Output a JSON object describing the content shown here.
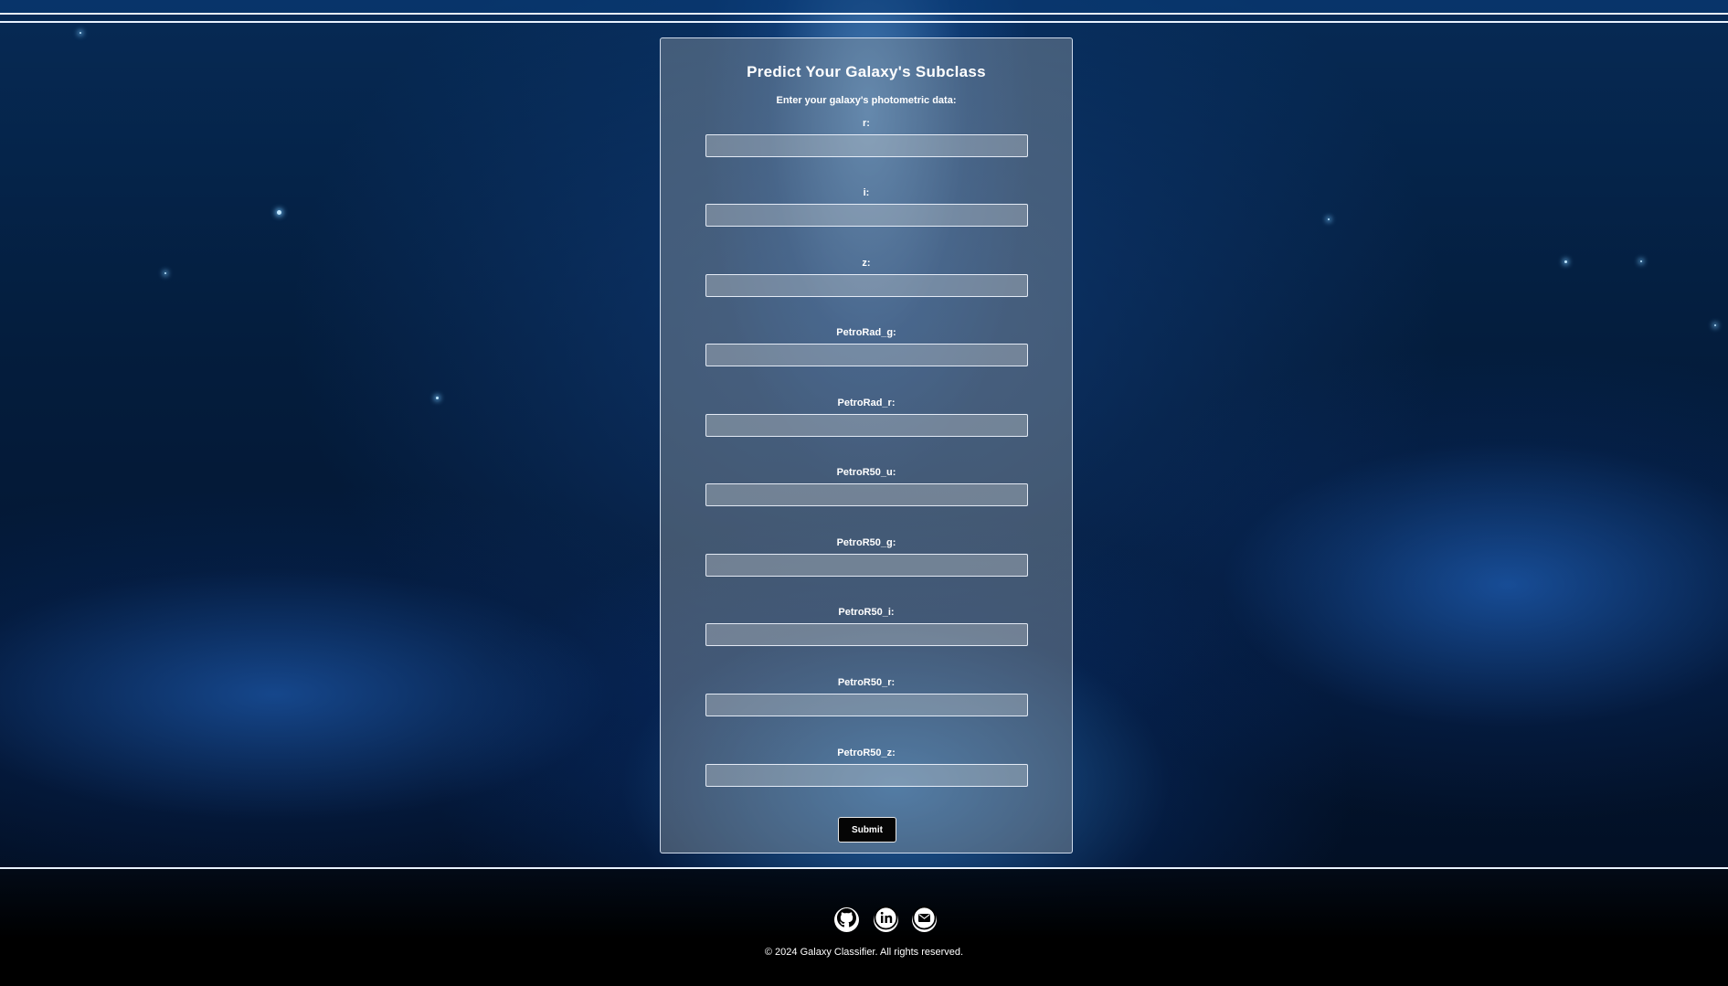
{
  "form": {
    "title": "Predict Your Galaxy's Subclass",
    "subtitle": "Enter your galaxy's photometric data:",
    "fields": [
      {
        "label": "r:",
        "value": ""
      },
      {
        "label": "i:",
        "value": ""
      },
      {
        "label": "z:",
        "value": ""
      },
      {
        "label": "PetroRad_g:",
        "value": ""
      },
      {
        "label": "PetroRad_r:",
        "value": ""
      },
      {
        "label": "PetroR50_u:",
        "value": ""
      },
      {
        "label": "PetroR50_g:",
        "value": ""
      },
      {
        "label": "PetroR50_i:",
        "value": ""
      },
      {
        "label": "PetroR50_r:",
        "value": ""
      },
      {
        "label": "PetroR50_z:",
        "value": ""
      }
    ],
    "submit_label": "Submit"
  },
  "footer": {
    "social": [
      "github-icon",
      "linkedin-icon",
      "email-icon"
    ],
    "copyright": "© 2024 Galaxy Classifier. All rights reserved."
  },
  "colors": {
    "card_bg": "#8c96a0",
    "border": "#e8f2ff",
    "button_bg": "#050505"
  }
}
